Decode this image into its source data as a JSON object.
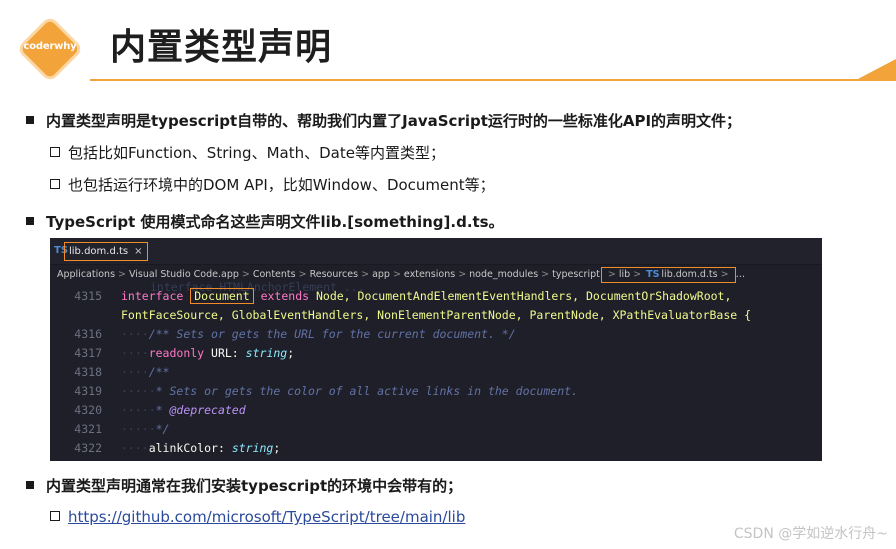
{
  "header": {
    "logo_text": "coderwhy",
    "title": "内置类型声明",
    "accent_color": "#f2a33a"
  },
  "bullets": {
    "b1": "内置类型声明是typescript自带的、帮助我们内置了JavaScript运行时的一些标准化API的声明文件；",
    "b1_sub1": "包括比如Function、String、Math、Date等内置类型；",
    "b1_sub2": "也包括运行环境中的DOM API，比如Window、Document等；",
    "b2": "TypeScript 使用模式命名这些声明文件lib.[something].d.ts。",
    "b3": "内置类型声明通常在我们安装typescript的环境中会带有的；",
    "b3_link": "https://github.com/microsoft/TypeScript/tree/main/lib"
  },
  "code_panel": {
    "tab": {
      "lang_badge": "TS",
      "filename": "lib.dom.d.ts",
      "close_glyph": "×"
    },
    "breadcrumb": {
      "path": [
        "Applications",
        "Visual Studio Code.app",
        "Contents",
        "Resources",
        "app",
        "extensions",
        "node_modules",
        "typescript"
      ],
      "boxed_lib": "lib",
      "boxed_ts": "TS",
      "boxed_file": "lib.dom.d.ts",
      "trail": "…",
      "separator": ">"
    },
    "ghost_line": "interface HTMLAnchorElement ...",
    "lines": {
      "l4315": {
        "num": "4315",
        "kw": "interface",
        "name": "Document",
        "extends_kw": "extends",
        "rest": "Node, DocumentAndElementEventHandlers, DocumentOrShadowRoot,"
      },
      "l4315b": {
        "text": "FontFaceSource, GlobalEventHandlers, NonElementParentNode, ParentNode, XPathEvaluatorBase {"
      },
      "l4316": {
        "num": "4316",
        "text": "/** Sets or gets the URL for the current document. */"
      },
      "l4317": {
        "num": "4317",
        "kw": "readonly",
        "prop": "URL:",
        "type": "string",
        "end": ";"
      },
      "l4318": {
        "num": "4318",
        "text": "/**"
      },
      "l4319": {
        "num": "4319",
        "text": "* Sets or gets the color of all active links in the document."
      },
      "l4320": {
        "num": "4320",
        "star": "*",
        "tag": "@deprecated"
      },
      "l4321": {
        "num": "4321",
        "text": "*/"
      },
      "l4322": {
        "num": "4322",
        "prop": "alinkColor:",
        "type": "string",
        "end": ";"
      }
    }
  },
  "watermark": "CSDN @学如逆水行舟~"
}
